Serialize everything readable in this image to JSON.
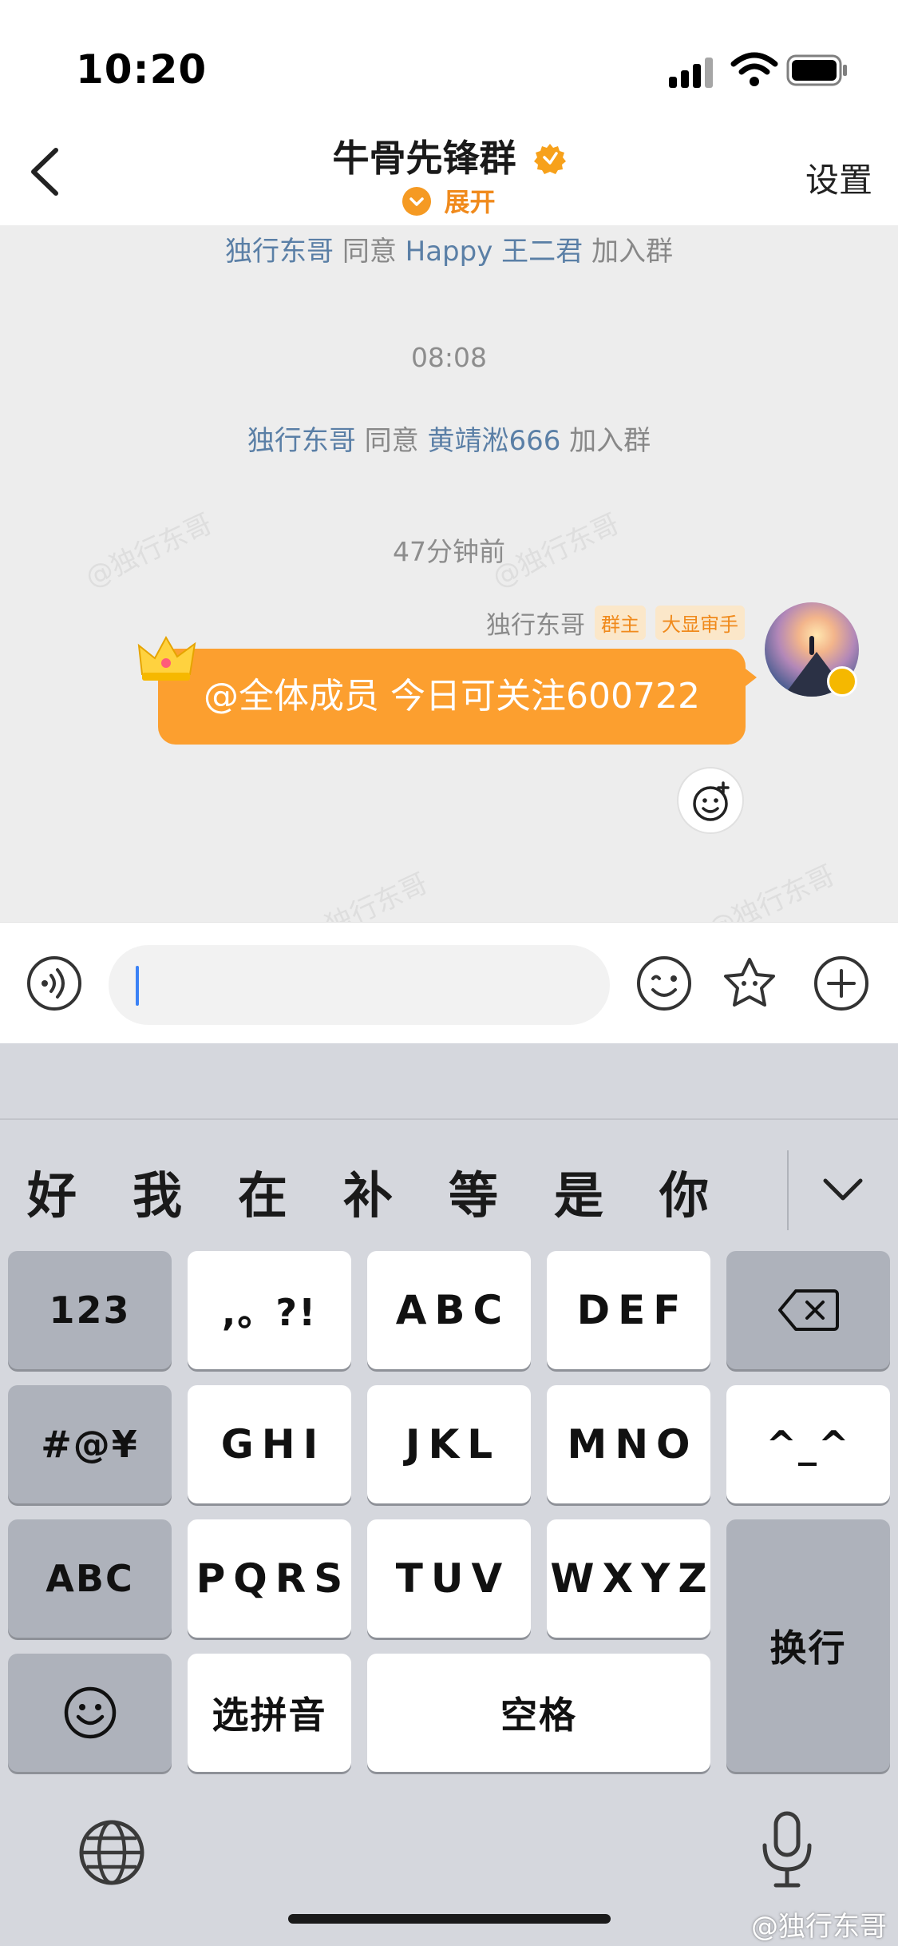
{
  "status": {
    "time": "10:20"
  },
  "header": {
    "title": "牛骨先锋群",
    "expand_label": "展开",
    "settings_label": "设置"
  },
  "chat": {
    "system_messages": [
      {
        "actor": "独行东哥",
        "verb": "同意",
        "target": "Happy 王二君",
        "suffix": "加入群"
      },
      {
        "actor": "独行东哥",
        "verb": "同意",
        "target": "黄靖淞666",
        "suffix": "加入群"
      }
    ],
    "timestamps": [
      "08:08",
      "47分钟前"
    ],
    "watermark": "@独行东哥",
    "message": {
      "sender": "独行东哥",
      "tags": [
        "群主",
        "大显审手"
      ],
      "text": "@全体成员 今日可关注600722"
    }
  },
  "input": {
    "value": "",
    "placeholder": ""
  },
  "keyboard": {
    "candidates": [
      "好",
      "我",
      "在",
      "补",
      "等",
      "是",
      "你"
    ],
    "rows": [
      [
        "123",
        ",。?!",
        "ABC",
        "DEF",
        "⌫"
      ],
      [
        "#@¥",
        "GHI",
        "JKL",
        "MNO",
        "^_^"
      ],
      [
        "ABC",
        "PQRS",
        "TUV",
        "WXYZ",
        "换行"
      ],
      [
        "☺",
        "选拼音",
        "空格"
      ]
    ]
  },
  "footer_watermark": "@独行东哥",
  "colors": {
    "accent": "#fc9f2f",
    "link": "#5a7fa6",
    "keyboard_bg": "#d5d7dd"
  }
}
